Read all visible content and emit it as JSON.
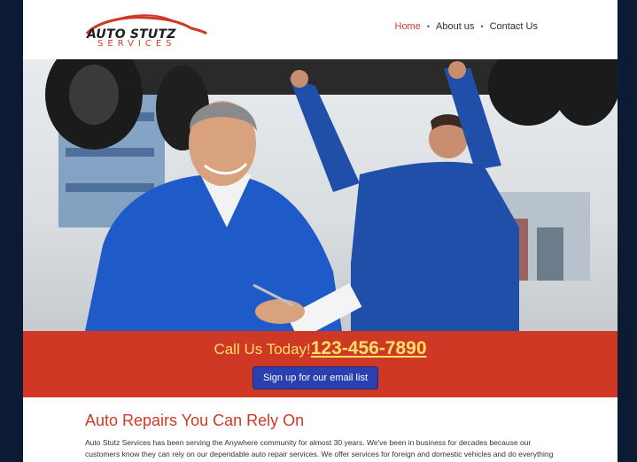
{
  "brand": {
    "name": "AUTO STUTZ",
    "tagline": "SERVICES",
    "accent_color": "#d03826",
    "cta_text_color": "#ffe066",
    "button_color": "#2a3fb0"
  },
  "nav": {
    "items": [
      {
        "label": "Home",
        "active": true
      },
      {
        "label": "About us",
        "active": false
      },
      {
        "label": "Contact Us",
        "active": false
      }
    ]
  },
  "cta": {
    "text": "Call Us Today!",
    "phone": "123-456-7890",
    "signup_label": "Sign up for our email list"
  },
  "content": {
    "heading": "Auto Repairs You Can Rely On",
    "body": "Auto Stutz Services has been serving the Anywhere community for almost 30 years. We've been in business for decades because our customers know they can rely on our dependable auto repair services. We offer services for foreign and domestic vehicles and do everything from diagnostic services and repairs to tuning and inspections."
  }
}
